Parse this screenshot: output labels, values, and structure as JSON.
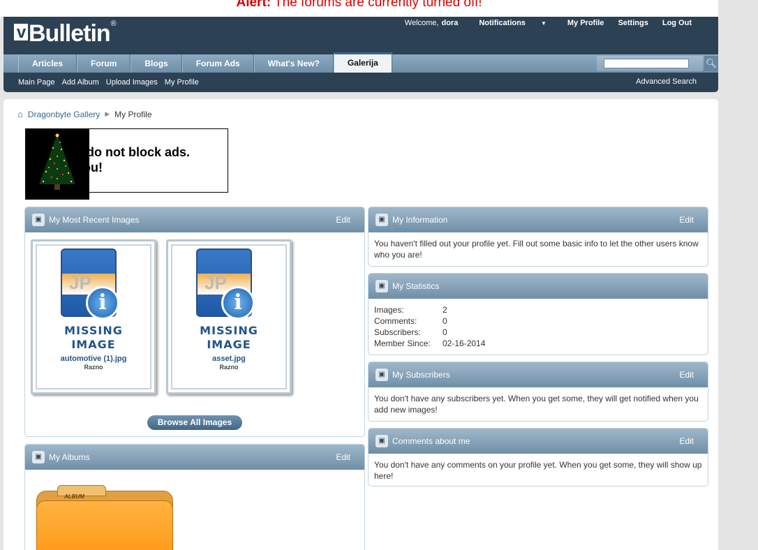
{
  "alert": {
    "prefix": "Alert:",
    "message": "The forums are currently turned off!"
  },
  "header": {
    "logo": "Bulletin",
    "logo_mark": "v",
    "logo_reg": "®",
    "welcome": "Welcome,",
    "username": "dora",
    "notifications": "Notifications",
    "my_profile": "My Profile",
    "settings": "Settings",
    "logout": "Log Out"
  },
  "tabs": [
    "Articles",
    "Forum",
    "Blogs",
    "Forum Ads",
    "What's New?",
    "Galerija"
  ],
  "subnav": {
    "items": [
      "Main Page",
      "Add Album",
      "Upload Images",
      "My Profile"
    ],
    "advanced_search": "Advanced Search"
  },
  "breadcrumb": {
    "root": "Dragonbyte Gallery",
    "current": "My Profile"
  },
  "ad": {
    "line1": "e do not block ads.",
    "line2": "you!"
  },
  "recent_images": {
    "title": "My Most Recent Images",
    "edit": "Edit",
    "items": [
      {
        "missing1": "MISSING",
        "missing2": "IMAGE",
        "file": "automotive (1).jpg",
        "category": "Razno"
      },
      {
        "missing1": "MISSING",
        "missing2": "IMAGE",
        "file": "asset.jpg",
        "category": "Razno"
      }
    ],
    "browse_button": "Browse All Images"
  },
  "albums": {
    "title": "My Albums",
    "edit": "Edit",
    "folder_label": "ALBUM"
  },
  "information": {
    "title": "My Information",
    "edit": "Edit",
    "text": "You haven't filled out your profile yet. Fill out some basic info to let the other users know who you are!"
  },
  "statistics": {
    "title": "My Statistics",
    "rows": [
      {
        "label": "Images:",
        "value": "2"
      },
      {
        "label": "Comments:",
        "value": "0"
      },
      {
        "label": "Subscribers:",
        "value": "0"
      },
      {
        "label": "Member Since:",
        "value": "02-16-2014"
      }
    ]
  },
  "subscribers": {
    "title": "My Subscribers",
    "edit": "Edit",
    "text": "You don't have any subscribers yet. When you get some, they will get notified when you add new images!"
  },
  "comments": {
    "title": "Comments about me",
    "edit": "Edit",
    "text": "You don't have any comments on your profile yet. When you get some, they will show up here!"
  },
  "icons": {
    "home": "home-icon",
    "search": "search-icon",
    "caret": "chevron-down-icon",
    "block": "block-icon",
    "image_placeholder": "missing-image-icon",
    "folder": "folder-icon"
  },
  "colors": {
    "header_bg": "#2d4155",
    "nav_bg": "#7d9cb5",
    "alert": "#dd0000",
    "link": "#34688f"
  }
}
